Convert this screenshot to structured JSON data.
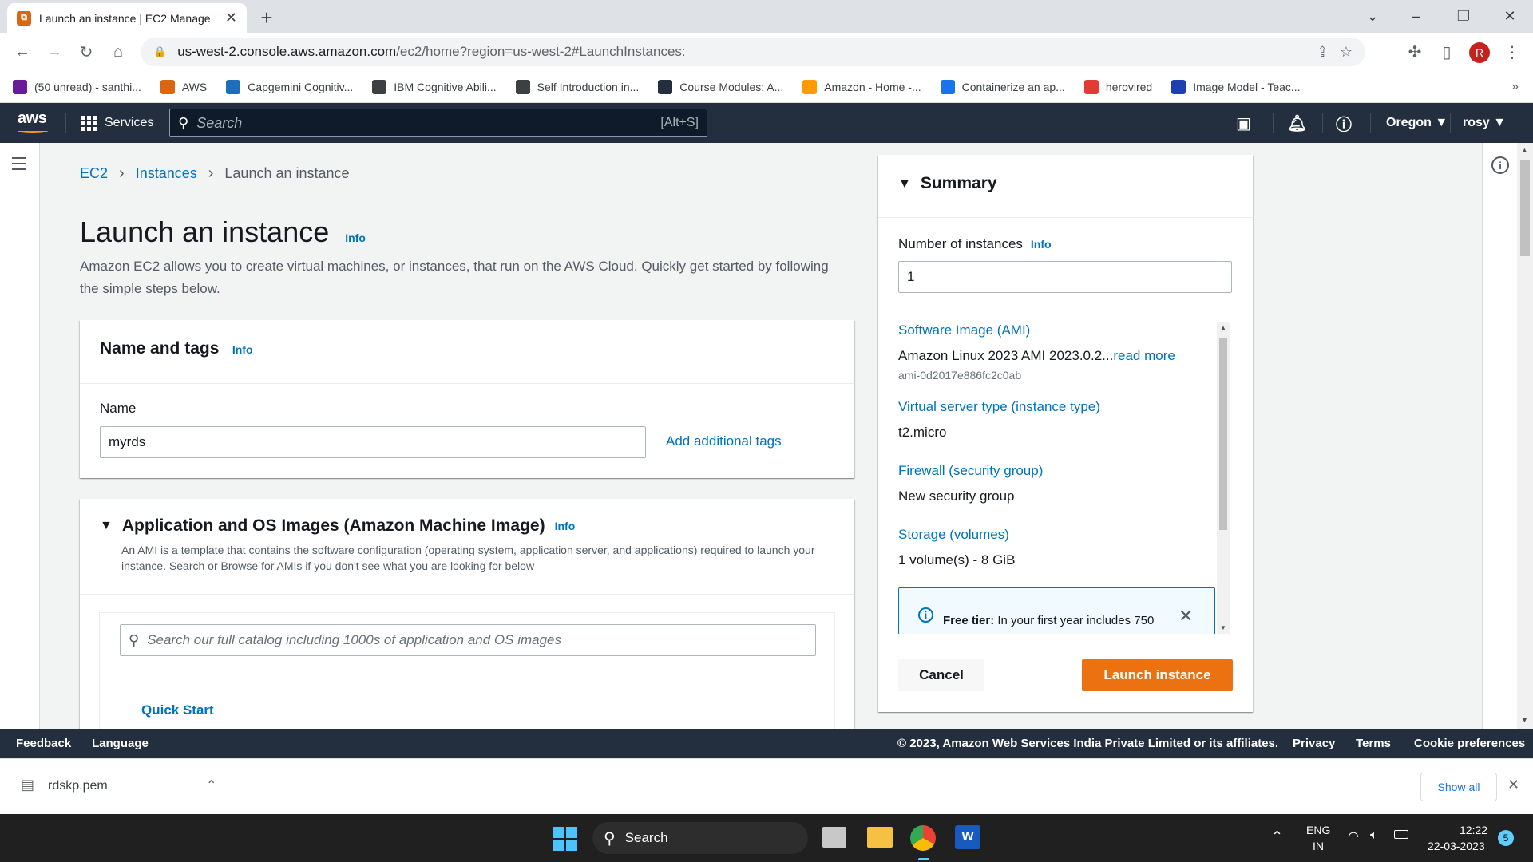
{
  "browser": {
    "tab_title": "Launch an instance | EC2 Manage",
    "url_host": "us-west-2.console.aws.amazon.com",
    "url_path": "/ec2/home?region=us-west-2#LaunchInstances:",
    "profile_initial": "R",
    "bookmarks": [
      {
        "label": "(50 unread) - santhi...",
        "icon": "mail-icon",
        "color": "#6a1b9a"
      },
      {
        "label": "AWS",
        "icon": "aws-icon",
        "color": "#d86613"
      },
      {
        "label": "Capgemini Cognitiv...",
        "icon": "capgemini-icon",
        "color": "#1f6fb8"
      },
      {
        "label": "IBM Cognitive Abili...",
        "icon": "globe-icon",
        "color": "#3c4043"
      },
      {
        "label": "Self Introduction in...",
        "icon": "globe-icon",
        "color": "#3c4043"
      },
      {
        "label": "Course Modules: A...",
        "icon": "aws-box-icon",
        "color": "#232f3e"
      },
      {
        "label": "Amazon - Home -...",
        "icon": "cube-icon",
        "color": "#ff9900"
      },
      {
        "label": "Containerize an ap...",
        "icon": "edge-icon",
        "color": "#1a73e8"
      },
      {
        "label": "herovired",
        "icon": "v-icon",
        "color": "#e53935"
      },
      {
        "label": "Image Model - Teac...",
        "icon": "tm-icon",
        "color": "#1e40af"
      }
    ]
  },
  "awsnav": {
    "logo": "aws",
    "services": "Services",
    "search_placeholder": "Search",
    "search_hint": "[Alt+S]",
    "region": "Oregon",
    "user": "rosy"
  },
  "breadcrumb": {
    "ec2": "EC2",
    "instances": "Instances",
    "current": "Launch an instance"
  },
  "page": {
    "title": "Launch an instance",
    "info": "Info",
    "description": "Amazon EC2 allows you to create virtual machines, or instances, that run on the AWS Cloud. Quickly get started by following the simple steps below."
  },
  "name_tags": {
    "heading": "Name and tags",
    "info": "Info",
    "name_label": "Name",
    "name_value": "myrds",
    "add_tags": "Add additional tags"
  },
  "ami": {
    "heading": "Application and OS Images (Amazon Machine Image)",
    "info": "Info",
    "description": "An AMI is a template that contains the software configuration (operating system, application server, and applications) required to launch your instance. Search or Browse for AMIs if you don't see what you are looking for below",
    "search_placeholder": "Search our full catalog including 1000s of application and OS images",
    "quick_start": "Quick Start"
  },
  "summary": {
    "heading": "Summary",
    "num_label": "Number of instances",
    "info": "Info",
    "num_value": "1",
    "ami_label": "Software Image (AMI)",
    "ami_value": "Amazon Linux 2023 AMI 2023.0.2...",
    "read_more": "read more",
    "ami_id": "ami-0d2017e886fc2c0ab",
    "type_label": "Virtual server type (instance type)",
    "type_value": "t2.micro",
    "fw_label": "Firewall (security group)",
    "fw_value": "New security group",
    "storage_label": "Storage (volumes)",
    "storage_value": "1 volume(s) - 8 GiB",
    "free_tier_bold": "Free tier:",
    "free_tier_text": "In your first year includes 750",
    "cancel": "Cancel",
    "launch": "Launch instance"
  },
  "footer": {
    "feedback": "Feedback",
    "language": "Language",
    "copyright": "© 2023, Amazon Web Services India Private Limited or its affiliates.",
    "privacy": "Privacy",
    "terms": "Terms",
    "cookie": "Cookie preferences"
  },
  "downloads": {
    "file": "rdskp.pem",
    "show_all": "Show all"
  },
  "taskbar": {
    "search": "Search",
    "lang1": "ENG",
    "lang2": "IN",
    "time": "12:22",
    "date": "22-03-2023",
    "badge": "5"
  },
  "colors": {
    "aws_nav": "#232f3e",
    "link": "#0073bb",
    "launch_button": "#ec7211"
  }
}
